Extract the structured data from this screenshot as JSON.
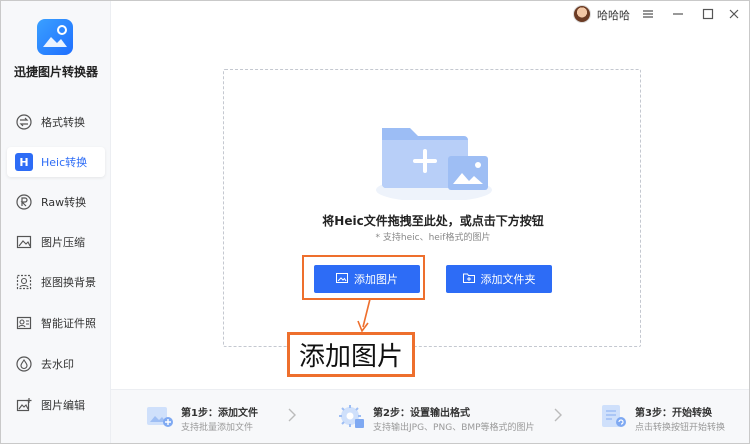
{
  "app": {
    "title": "迅捷图片转换器"
  },
  "user": {
    "name": "哈哈哈"
  },
  "sidebar": {
    "items": [
      {
        "label": "格式转换",
        "icon": "swap-arrows-icon",
        "active": false
      },
      {
        "label": "Heic转换",
        "icon": "heic-h-icon",
        "badge": "H",
        "active": true
      },
      {
        "label": "Raw转换",
        "icon": "raw-r-icon",
        "active": false
      },
      {
        "label": "图片压缩",
        "icon": "image-compress-icon",
        "active": false
      },
      {
        "label": "抠图换背景",
        "icon": "cutout-icon",
        "active": false
      },
      {
        "label": "智能证件照",
        "icon": "id-photo-icon",
        "active": false
      },
      {
        "label": "去水印",
        "icon": "watermark-drop-icon",
        "active": false
      },
      {
        "label": "图片编辑",
        "icon": "image-edit-icon",
        "active": false
      }
    ]
  },
  "main": {
    "instruction": "将Heic文件拖拽至此处，或点击下方按钮",
    "support_hint": "* 支持heic、heif格式的图片",
    "add_image_label": "添加图片",
    "add_folder_label": "添加文件夹"
  },
  "annotation": {
    "callout_text": "添加图片",
    "color": "#ee6f2d"
  },
  "steps": [
    {
      "title": "第1步：添加文件",
      "desc": "支持批量添加文件"
    },
    {
      "title": "第2步：设置输出格式",
      "desc": "支持输出JPG、PNG、BMP等格式的图片"
    },
    {
      "title": "第3步：开始转换",
      "desc": "点击转换按钮开始转换"
    }
  ],
  "colors": {
    "accent": "#2d6cf6",
    "highlight": "#ee6f2d"
  }
}
